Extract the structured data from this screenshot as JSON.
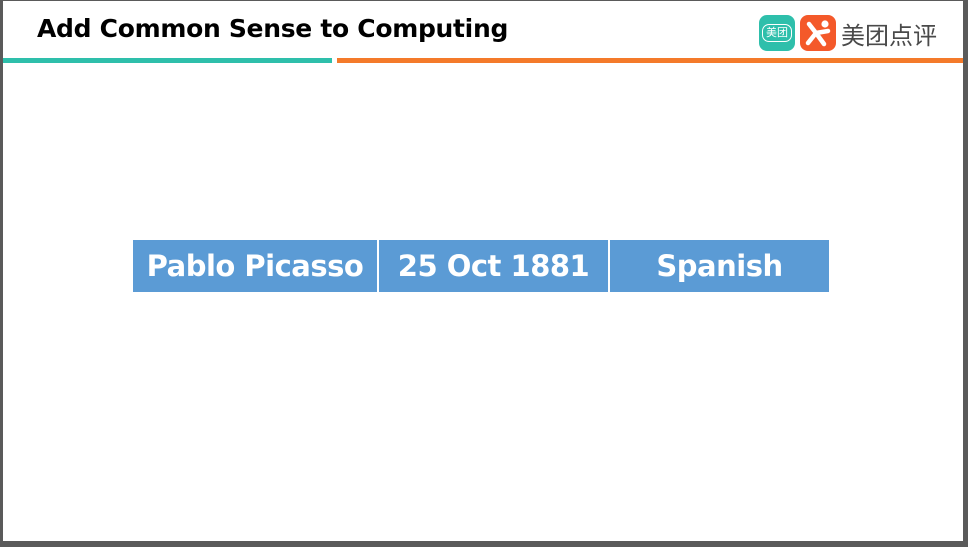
{
  "slide": {
    "title": "Add Common Sense to Computing"
  },
  "logo": {
    "meituan_mark_text": "美团",
    "brand_text": "美团点评"
  },
  "fact_row": [
    "Pablo Picasso",
    "25 Oct 1881",
    "Spanish"
  ],
  "colors": {
    "bar_left": "#2ebfab",
    "bar_right": "#f47a2a",
    "cell_background": "#5b9bd5",
    "meituan_icon": "#2ebfab",
    "dianping_icon": "#f4592a"
  },
  "icons": [
    "meituan-logo-icon",
    "dianping-logo-icon"
  ]
}
